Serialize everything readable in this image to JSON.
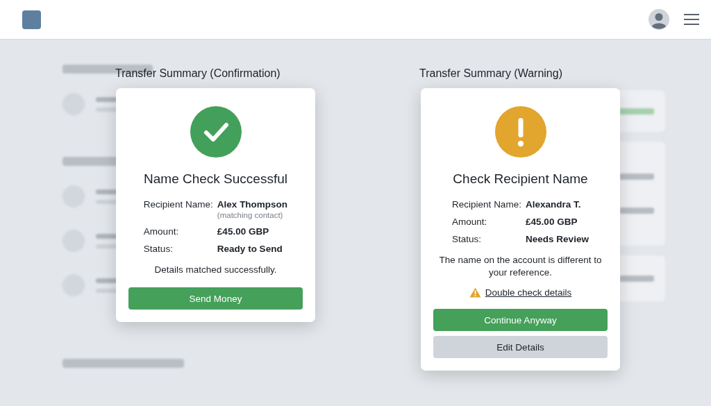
{
  "dialogs": [
    {
      "caption": "Transfer Summary (Confirmation)",
      "kind": "success",
      "title": "Name Check Successful",
      "details": [
        {
          "label": "Recipient Name:",
          "value": "Alex Thompson",
          "note": "(matching contact)"
        },
        {
          "label": "Amount:",
          "value": "£45.00 GBP"
        },
        {
          "label": "Status:",
          "value": "Ready to Send"
        }
      ],
      "message": "Details matched successfully.",
      "buttons": [
        {
          "label": "Send Money",
          "kind": "primary"
        }
      ]
    },
    {
      "caption": "Transfer Summary (Warning)",
      "kind": "warning",
      "title": "Check Recipient Name",
      "details": [
        {
          "label": "Recipient Name:",
          "value": "Alexandra T."
        },
        {
          "label": "Amount:",
          "value": "£45.00 GBP"
        },
        {
          "label": "Status:",
          "value": "Needs Review"
        }
      ],
      "message": "The name on the account is different to your reference.",
      "link": "Double check details",
      "buttons": [
        {
          "label": "Continue Anyway",
          "kind": "primary"
        },
        {
          "label": "Edit Details",
          "kind": "secondary"
        }
      ]
    }
  ]
}
